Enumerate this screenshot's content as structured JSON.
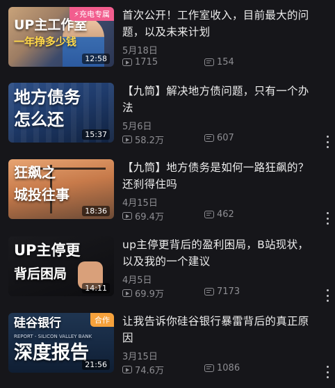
{
  "videos": [
    {
      "thumb_text": [
        "UP主工作室",
        "一年挣多少钱"
      ],
      "badge": "充电专属",
      "duration": "12:58",
      "title": "首次公开！工作室收入，目前最大的问题，以及未来计划",
      "date": "5月18日",
      "views": "1715",
      "comments": "154"
    },
    {
      "thumb_text": [
        "地方债务",
        "怎么还"
      ],
      "badge": "",
      "duration": "15:37",
      "title": "【九筒】解决地方债问题，只有一个办法",
      "date": "5月6日",
      "views": "58.2万",
      "comments": "607"
    },
    {
      "thumb_text": [
        "狂飙之",
        "城投往事"
      ],
      "badge": "",
      "duration": "18:36",
      "title": "【九筒】地方债务是如何一路狂飙的？还刹得住吗",
      "date": "4月15日",
      "views": "69.4万",
      "comments": "462"
    },
    {
      "thumb_text": [
        "UP主停更",
        "背后困局"
      ],
      "badge": "",
      "duration": "14:11",
      "title": "up主停更背后的盈利困局，B站现状，以及我的一个建议",
      "date": "4月5日",
      "views": "69.9万",
      "comments": "7173"
    },
    {
      "thumb_text": [
        "硅谷银行",
        "REPORT - SILICON VALLEY BANK",
        "深度报告"
      ],
      "badge": "合作",
      "duration": "21:56",
      "title": "让我告诉你硅谷银行暴雷背后的真正原因",
      "date": "3月15日",
      "views": "74.6万",
      "comments": "1086"
    }
  ],
  "icons": {
    "views": "play-count-icon",
    "comments": "comment-count-icon",
    "more": "more-vertical-icon"
  },
  "colors": {
    "background": "#16161a",
    "secondary_text": "#8e8e93",
    "badge_pink": "#f25d8e",
    "badge_orange": "#f6a23c"
  }
}
